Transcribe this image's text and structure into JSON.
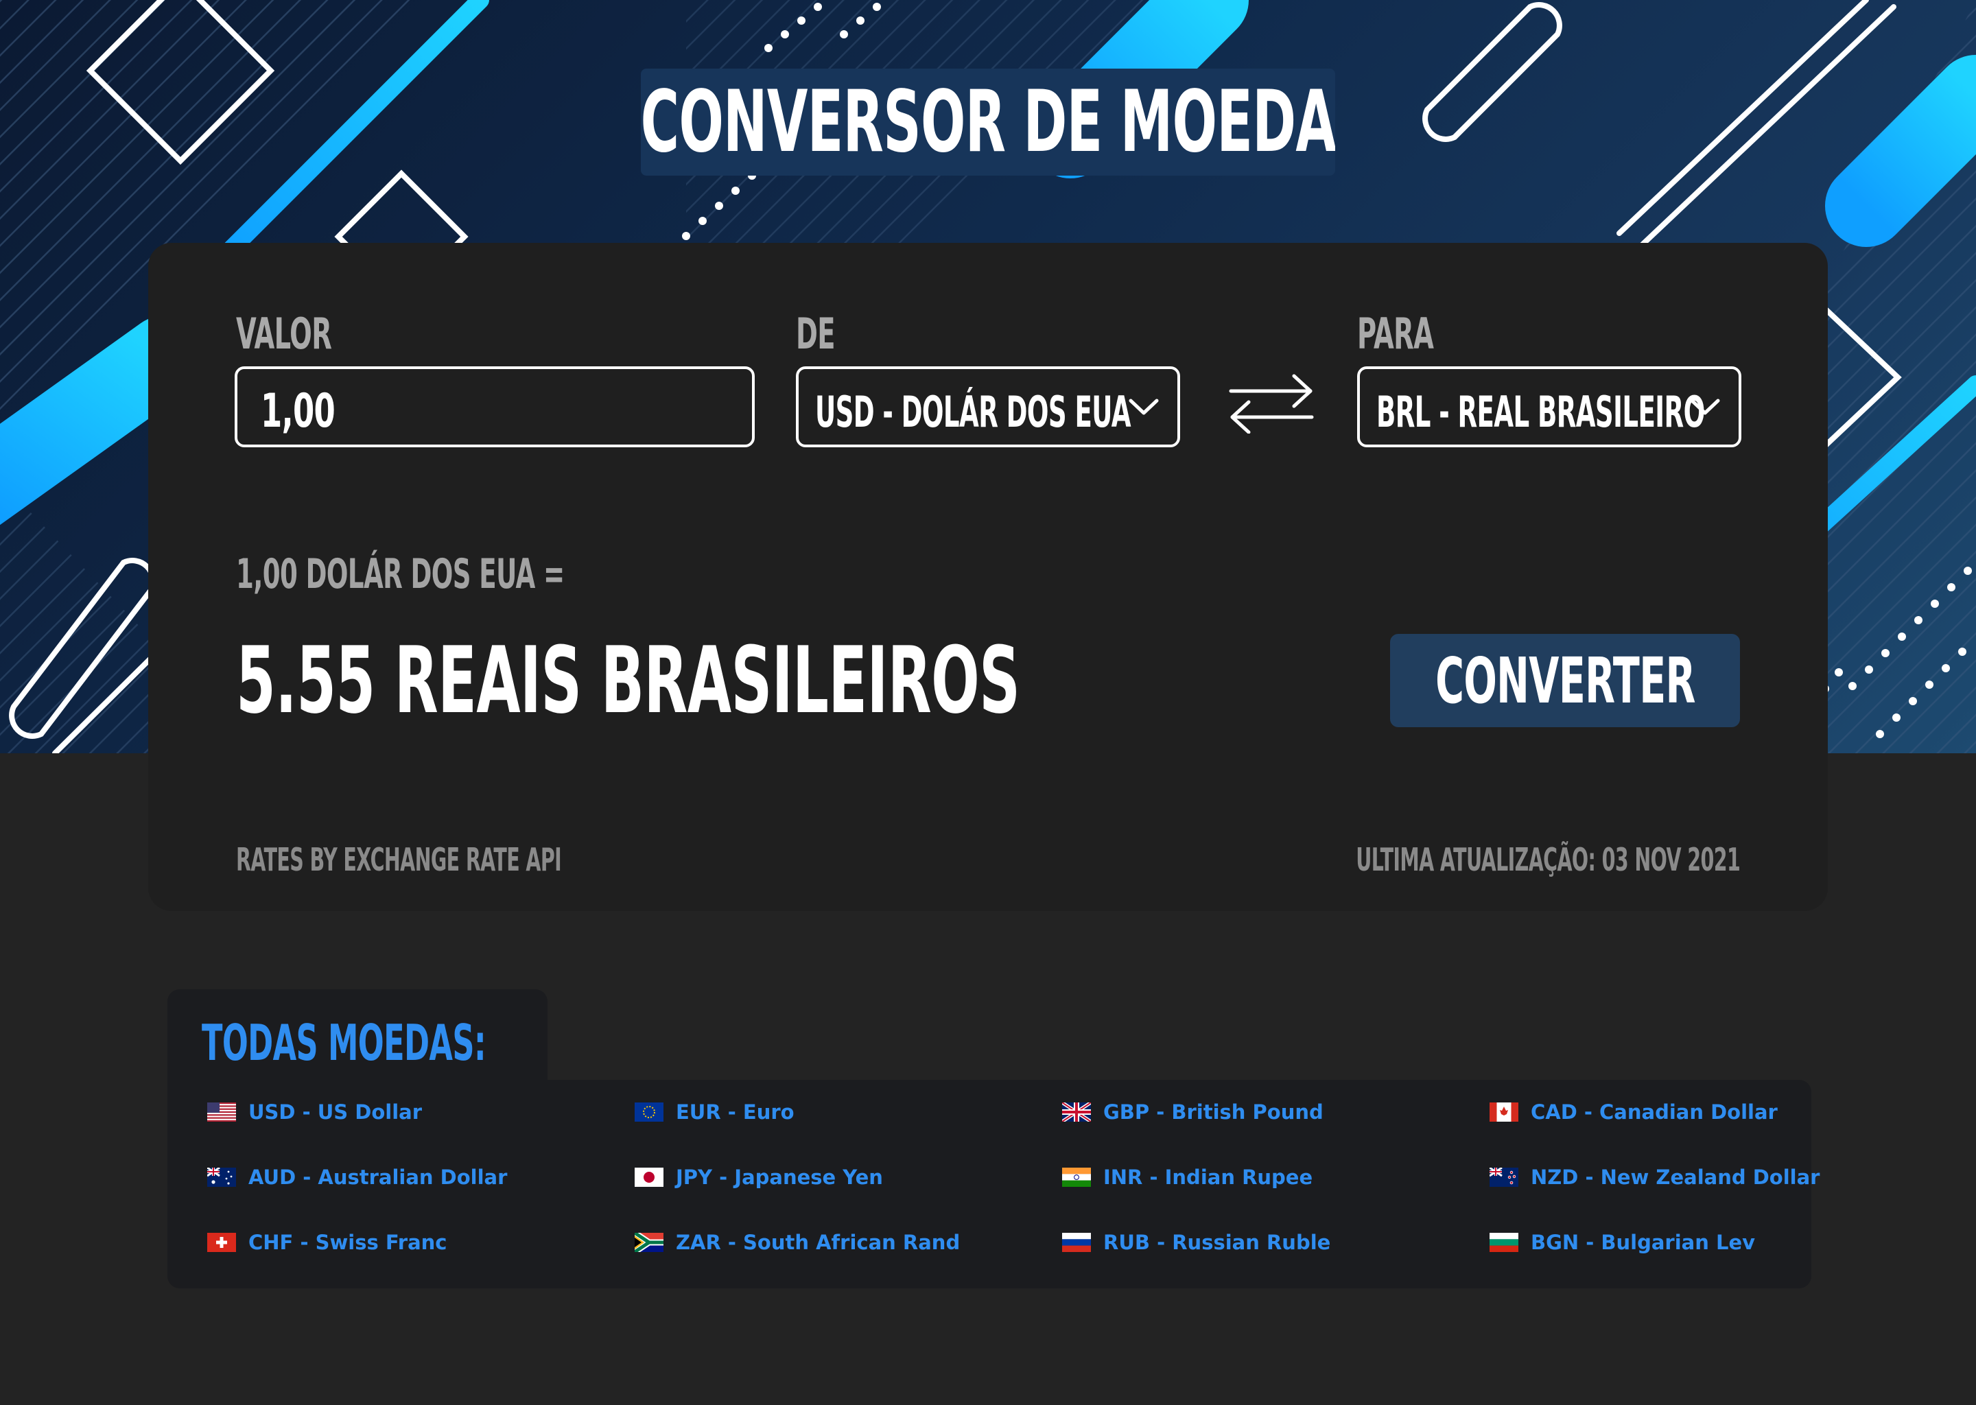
{
  "title": "CONVERSOR DE MOEDA",
  "form": {
    "amount_label": "VALOR",
    "amount_value": "1,00",
    "from_label": "DE",
    "from_value": "USD - DOLÁR DOS EUA",
    "to_label": "PARA",
    "to_value": "BRL - REAL BRASILEIRO"
  },
  "result": {
    "equation": "1,00 DOLÁR DOS EUA =",
    "value": "5.55 REAIS BRASILEIROS"
  },
  "convert_button": "CONVERTER",
  "footer": {
    "credit": "RATES BY EXCHANGE RATE API",
    "updated": "ULTIMA ATUALIZAÇÃO: 03 NOV 2021"
  },
  "currencies": {
    "heading": "TODAS MOEDAS:",
    "items": [
      {
        "label": "USD - US Dollar",
        "flag": "us-flag-icon"
      },
      {
        "label": "EUR - Euro",
        "flag": "eu-flag-icon"
      },
      {
        "label": "GBP - British Pound",
        "flag": "uk-flag-icon"
      },
      {
        "label": "CAD - Canadian Dollar",
        "flag": "canada-flag-icon"
      },
      {
        "label": "AUD - Australian Dollar",
        "flag": "australia-flag-icon"
      },
      {
        "label": "JPY - Japanese Yen",
        "flag": "japan-flag-icon"
      },
      {
        "label": "INR - Indian Rupee",
        "flag": "india-flag-icon"
      },
      {
        "label": "NZD - New Zealand Dollar",
        "flag": "new-zealand-flag-icon"
      },
      {
        "label": "CHF - Swiss Franc",
        "flag": "switzerland-flag-icon"
      },
      {
        "label": "ZAR - South African Rand",
        "flag": "south-africa-flag-icon"
      },
      {
        "label": "RUB - Russian Ruble",
        "flag": "russia-flag-icon"
      },
      {
        "label": "BGN - Bulgarian Lev",
        "flag": "bulgaria-flag-icon"
      }
    ]
  },
  "colors": {
    "accent_blue": "#2f8df0",
    "button_bg": "#213e5e",
    "card_bg": "#1f1f1f",
    "page_bg": "#232323"
  }
}
